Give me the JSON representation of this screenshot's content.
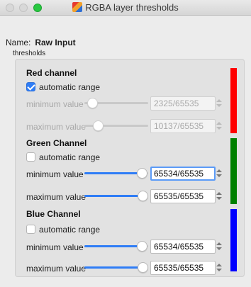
{
  "window": {
    "title": "RGBA layer thresholds"
  },
  "name_row": {
    "label": "Name:",
    "value": "Raw Input"
  },
  "thresholds_label": "thresholds",
  "channels": [
    {
      "title": "Red channel",
      "automatic_range": {
        "label": "automatic range",
        "checked": true
      },
      "minimum": {
        "label": "minimum value",
        "value": "2325/65535",
        "level": 0.035,
        "enabled": false
      },
      "maximum": {
        "label": "maximum value",
        "value": "10137/65535",
        "level": 0.155,
        "enabled": false
      },
      "color": "#ff0000"
    },
    {
      "title": "Green Channel",
      "automatic_range": {
        "label": "automatic range",
        "checked": false
      },
      "minimum": {
        "label": "minimum value",
        "value": "65534/65535",
        "level": 0.99998,
        "enabled": true
      },
      "maximum": {
        "label": "maximum value",
        "value": "65535/65535",
        "level": 1.0,
        "enabled": true
      },
      "color": "#008000"
    },
    {
      "title": "Blue Channel",
      "automatic_range": {
        "label": "automatic range",
        "checked": false
      },
      "minimum": {
        "label": "minimum value",
        "value": "65534/65535",
        "level": 0.99998,
        "enabled": true
      },
      "maximum": {
        "label": "maximum value",
        "value": "65535/65535",
        "level": 1.0,
        "enabled": true
      },
      "color": "#0000ff"
    }
  ],
  "colors": {
    "accent": "#2f7df6",
    "focus_ring": "#5b9bf7"
  }
}
